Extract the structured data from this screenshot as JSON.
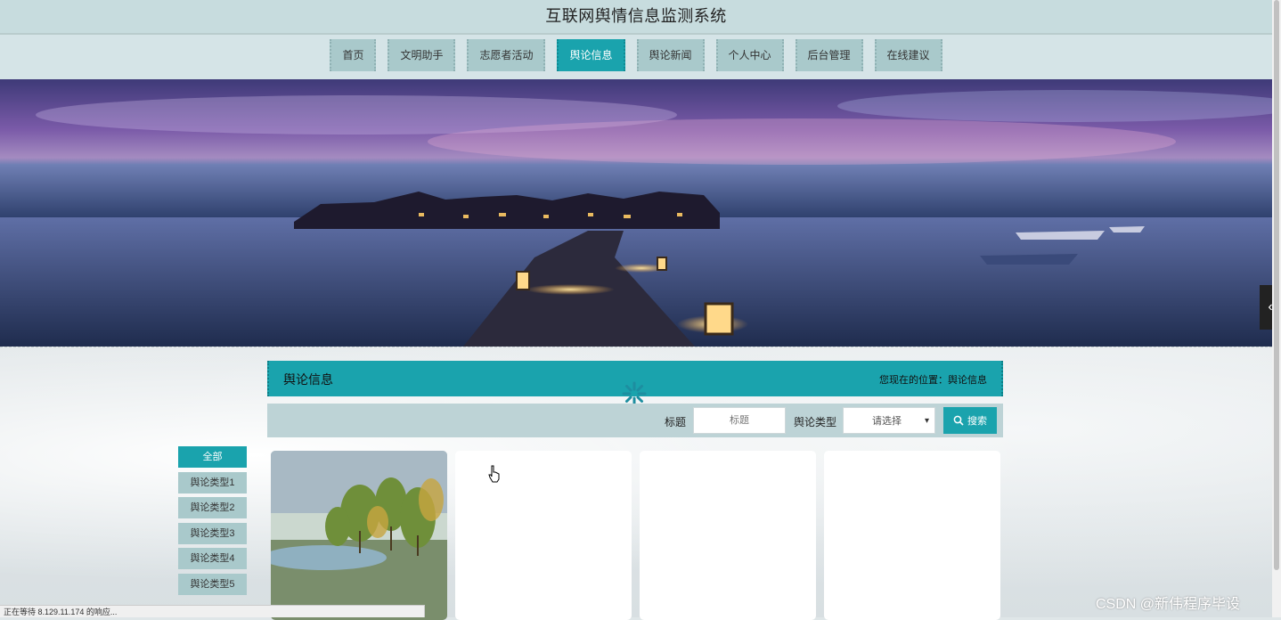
{
  "header": {
    "title": "互联网舆情信息监测系统"
  },
  "nav": {
    "items": [
      {
        "label": "首页"
      },
      {
        "label": "文明助手"
      },
      {
        "label": "志愿者活动"
      },
      {
        "label": "舆论信息"
      },
      {
        "label": "舆论新闻"
      },
      {
        "label": "个人中心"
      },
      {
        "label": "后台管理"
      },
      {
        "label": "在线建议"
      }
    ],
    "active": "舆论信息"
  },
  "page": {
    "title": "舆论信息",
    "breadcrumb": "您现在的位置：舆论信息"
  },
  "search": {
    "title_label": "标题",
    "title_placeholder": "标题",
    "type_label": "舆论类型",
    "type_value": "请选择",
    "button_label": "搜索"
  },
  "categories": [
    {
      "label": "全部"
    },
    {
      "label": "舆论类型1"
    },
    {
      "label": "舆论类型2"
    },
    {
      "label": "舆论类型3"
    },
    {
      "label": "舆论类型4"
    },
    {
      "label": "舆论类型5"
    }
  ],
  "status_bar": {
    "text": "正在等待 8.129.11.174 的响应..."
  },
  "watermark": "CSDN @新伟程序毕设",
  "colors": {
    "accent": "#1aa3ad",
    "nav_bg": "#a9c9cb",
    "header_bg": "#c7dcde"
  }
}
